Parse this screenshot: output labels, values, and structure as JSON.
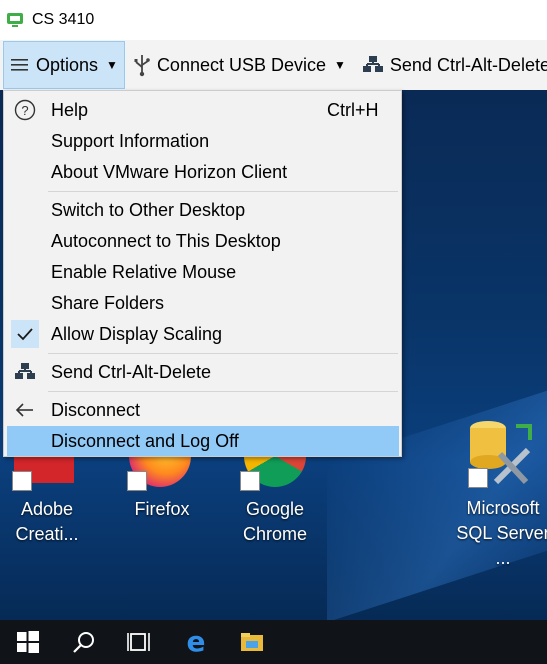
{
  "window": {
    "title": "CS 3410"
  },
  "toolbar": {
    "options_label": "Options",
    "usb_label": "Connect USB Device",
    "cad_label": "Send Ctrl-Alt-Delete"
  },
  "menu": {
    "help": {
      "label": "Help",
      "shortcut": "Ctrl+H"
    },
    "support": "Support Information",
    "about": "About VMware Horizon Client",
    "switch": "Switch to Other Desktop",
    "autoconnect": "Autoconnect to This Desktop",
    "relative_mouse": "Enable Relative Mouse",
    "share_folders": "Share Folders",
    "display_scaling": {
      "label": "Allow Display Scaling",
      "checked": true
    },
    "send_cad": "Send Ctrl-Alt-Delete",
    "disconnect": "Disconnect",
    "disconnect_logoff": "Disconnect and Log Off"
  },
  "desktop": {
    "icons": [
      {
        "line1": "Adobe",
        "line2": "Creati..."
      },
      {
        "line1": "Firefox",
        "line2": ""
      },
      {
        "line1": "Google",
        "line2": "Chrome"
      },
      {
        "line1": "Microsoft",
        "line2": "SQL Server ..."
      }
    ]
  },
  "taskbar": {
    "items": [
      "start-icon",
      "search-icon",
      "task-view-icon",
      "edge-icon",
      "file-explorer-icon"
    ]
  },
  "colors": {
    "highlight": "#91c9f7",
    "toolbar_active": "#cce4f7",
    "app_green": "#3fae49"
  }
}
